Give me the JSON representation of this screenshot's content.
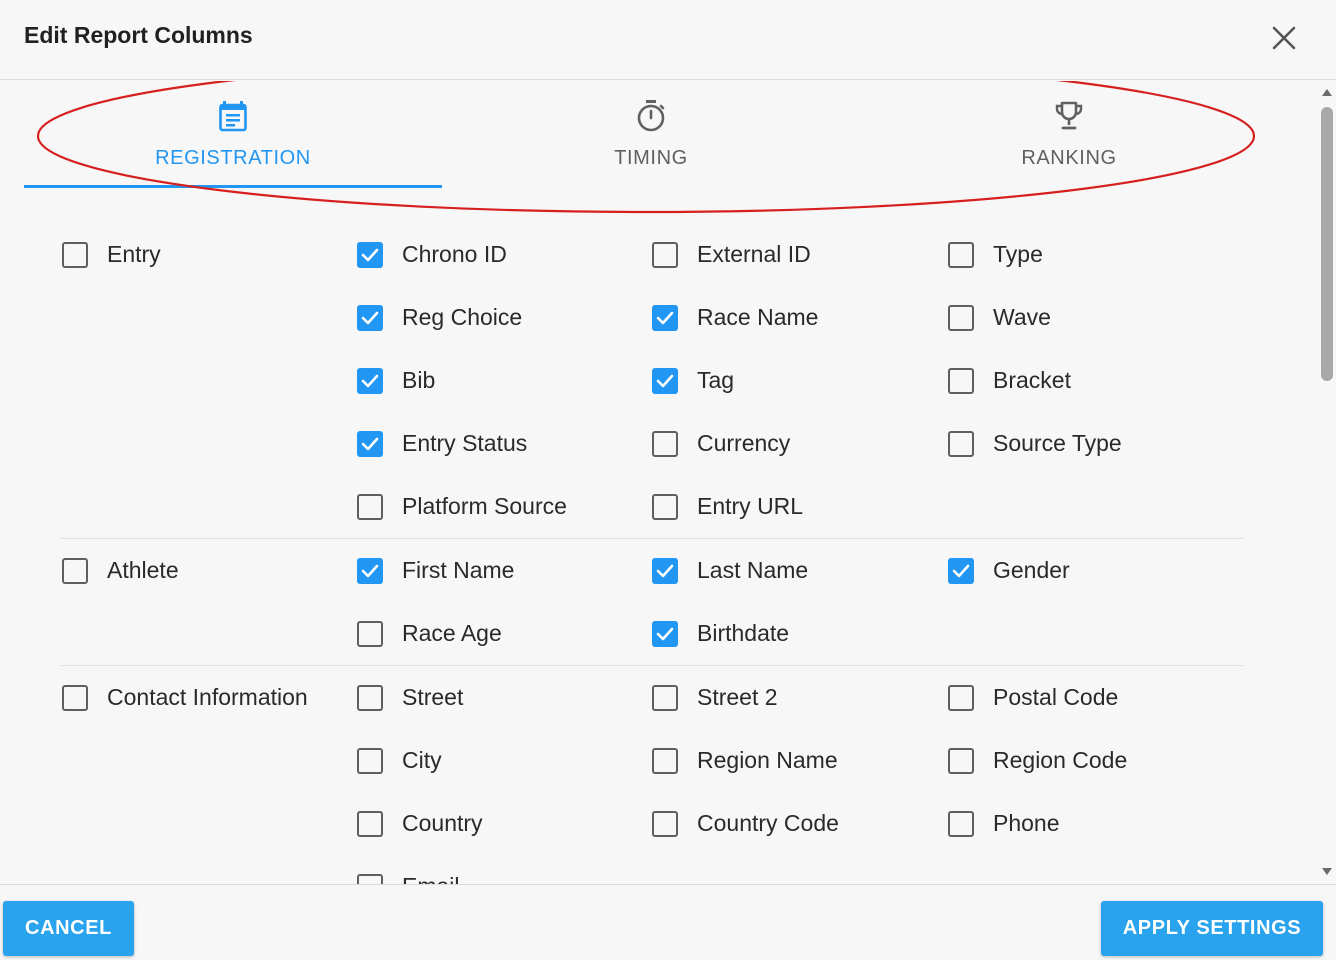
{
  "dialog": {
    "title": "Edit Report Columns"
  },
  "tabs": [
    {
      "label": "REGISTRATION",
      "icon": "calendar-icon",
      "active": true
    },
    {
      "label": "TIMING",
      "icon": "stopwatch-icon",
      "active": false
    },
    {
      "label": "RANKING",
      "icon": "trophy-icon",
      "active": false
    }
  ],
  "colors": {
    "accent": "#2196f3",
    "annotation": "#d62020",
    "button": "#29a3ee"
  },
  "groups": [
    {
      "label": "Entry",
      "checked": false,
      "columns": [
        {
          "label": "Chrono ID",
          "checked": true
        },
        {
          "label": "External ID",
          "checked": false
        },
        {
          "label": "Type",
          "checked": false
        },
        {
          "label": "Reg Choice",
          "checked": true
        },
        {
          "label": "Race Name",
          "checked": true
        },
        {
          "label": "Wave",
          "checked": false
        },
        {
          "label": "Bib",
          "checked": true
        },
        {
          "label": "Tag",
          "checked": true
        },
        {
          "label": "Bracket",
          "checked": false
        },
        {
          "label": "Entry Status",
          "checked": true
        },
        {
          "label": "Currency",
          "checked": false
        },
        {
          "label": "Source Type",
          "checked": false
        },
        {
          "label": "Platform Source",
          "checked": false
        },
        {
          "label": "Entry URL",
          "checked": false
        }
      ]
    },
    {
      "label": "Athlete",
      "checked": false,
      "columns": [
        {
          "label": "First Name",
          "checked": true
        },
        {
          "label": "Last Name",
          "checked": true
        },
        {
          "label": "Gender",
          "checked": true
        },
        {
          "label": "Race Age",
          "checked": false
        },
        {
          "label": "Birthdate",
          "checked": true
        }
      ]
    },
    {
      "label": "Contact Information",
      "checked": false,
      "columns": [
        {
          "label": "Street",
          "checked": false
        },
        {
          "label": "Street 2",
          "checked": false
        },
        {
          "label": "Postal Code",
          "checked": false
        },
        {
          "label": "City",
          "checked": false
        },
        {
          "label": "Region Name",
          "checked": false
        },
        {
          "label": "Region Code",
          "checked": false
        },
        {
          "label": "Country",
          "checked": false
        },
        {
          "label": "Country Code",
          "checked": false
        },
        {
          "label": "Phone",
          "checked": false
        },
        {
          "label": "Email",
          "checked": false
        }
      ]
    }
  ],
  "footer": {
    "cancel_label": "CANCEL",
    "apply_label": "APPLY SETTINGS"
  }
}
